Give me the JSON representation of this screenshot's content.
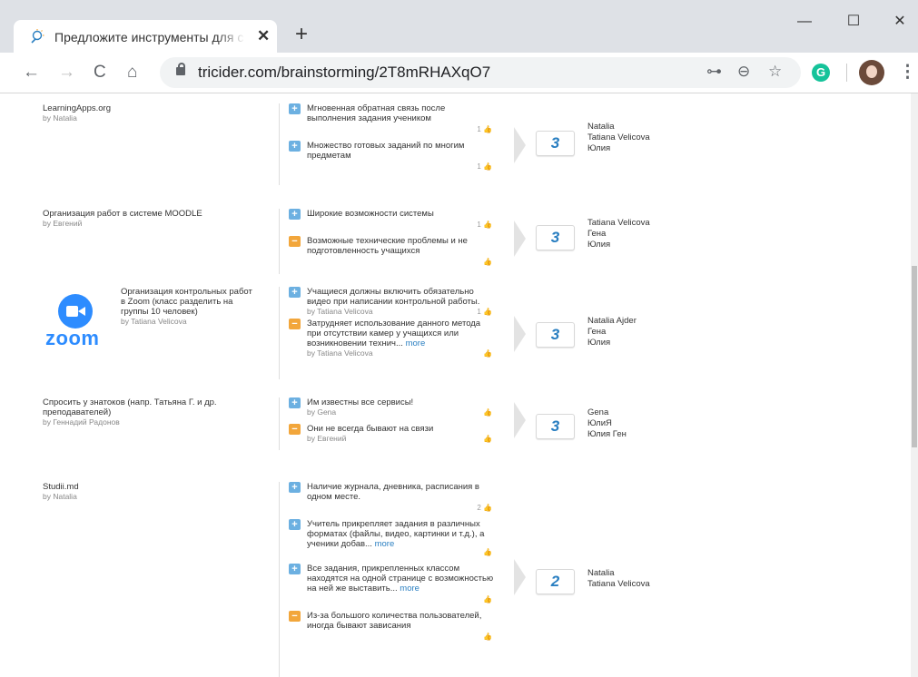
{
  "browser": {
    "tab_title": "Предложите инструменты для с",
    "tab_close": "✕",
    "new_tab": "+",
    "url": "tricider.com/brainstorming/2T8mRHAXqO7",
    "back": "←",
    "forward": "→",
    "reload": "C",
    "home": "⌂",
    "key": "⊶",
    "zoom": "⊖",
    "star": "☆",
    "grammarly": "G",
    "menu": "⋮",
    "minimize": "—",
    "maximize": "☐",
    "close": "✕"
  },
  "ideas": [
    {
      "title": "LearningApps.org",
      "by": "by Natalia",
      "args": [
        {
          "type": "pro",
          "text": "Мгновенная обратная связь после выполнения задания учеником",
          "likes": "1 👍"
        },
        {
          "type": "pro",
          "text": "Множество готовых заданий по многим предметам",
          "likes": "1 👍"
        }
      ],
      "votes": "3",
      "voters": [
        "Natalia",
        "Tatiana Velicova",
        "Юлия"
      ]
    },
    {
      "title": "Организация работ в системе MOODLE",
      "by": "by Евгений",
      "args": [
        {
          "type": "pro",
          "text": "Широкие возможности системы",
          "likes": "1 👍"
        },
        {
          "type": "con",
          "text": "Возможные технические проблемы и не подготовленность учащихся",
          "likes": "👍"
        }
      ],
      "votes": "3",
      "voters": [
        "Tatiana Velicova",
        "Гена",
        "Юлия"
      ]
    },
    {
      "title": "Организация контрольных работ в Zoom (класс разделить на группы 10 человек)",
      "by": "by Tatiana Velicova",
      "image_word": "zoom",
      "args": [
        {
          "type": "pro",
          "text": "Учащиеся должны включить обязательно видео при написании контрольной работы.",
          "byline": "by Tatiana Velicova",
          "likes": "1 👍"
        },
        {
          "type": "con",
          "text": "Затрудняет использование данного метода при отсутствии камер у учащихся или возникновении технич...",
          "more": "more",
          "byline": "by Tatiana Velicova",
          "likes": "👍"
        }
      ],
      "votes": "3",
      "voters": [
        "Natalia Ajder",
        "Гена",
        "Юлия"
      ]
    },
    {
      "title": "Спросить у знатоков (напр. Татьяна Г. и др. преподавателей)",
      "by": "by Геннадий Радонов",
      "args": [
        {
          "type": "pro",
          "text": "Им известны все сервисы!",
          "byline": "by Gena",
          "likes": "👍"
        },
        {
          "type": "con",
          "text": "Они не всегда бывают на связи",
          "byline": "by Евгений",
          "likes": "👍"
        }
      ],
      "votes": "3",
      "voters": [
        "Gena",
        "ЮлиЯ",
        "Юлия Ген"
      ]
    },
    {
      "title": "Studii.md",
      "by": "by Natalia",
      "args": [
        {
          "type": "pro",
          "text": "Наличие журнала, дневника, расписания в одном месте.",
          "likes": "2 👍"
        },
        {
          "type": "pro",
          "text": "Учитель прикрепляет задания в различных форматах (файлы, видео, картинки и т.д.), а ученики добав...",
          "more": "more",
          "likes": "👍"
        },
        {
          "type": "pro",
          "text": "Все задания, прикрепленных классом находятся на одной странице с возможностью на ней же выставить...",
          "more": "more",
          "likes": "👍"
        },
        {
          "type": "con",
          "text": "Из-за большого количества пользователей, иногда бывают зависания",
          "likes": "👍"
        }
      ],
      "votes": "2",
      "voters": [
        "Natalia",
        "Tatiana Velicova"
      ]
    }
  ],
  "signs": {
    "pro": "+",
    "con": "−"
  },
  "colors": {
    "accent": "#2a7fc1",
    "pro": "#6cb0e1",
    "con": "#f2a63b",
    "zoom": "#2d8cff"
  }
}
